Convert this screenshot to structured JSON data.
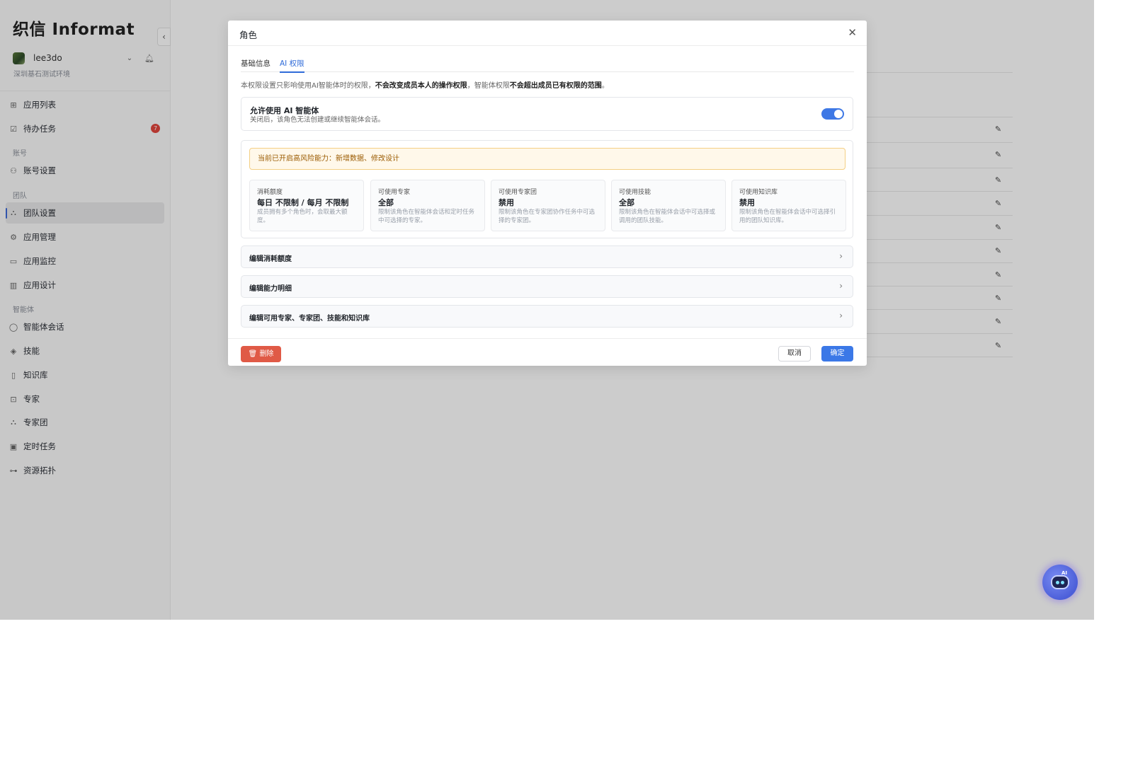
{
  "brand": {
    "name": "织信 Informat"
  },
  "user": {
    "name": "lee3do",
    "org": "深圳基石测试环境"
  },
  "sidebar": {
    "items": [
      {
        "label": "应用列表",
        "icon": "grid-icon"
      },
      {
        "label": "待办任务",
        "icon": "checkbox-icon",
        "badge": "7"
      }
    ],
    "section_account": "账号",
    "account_items": [
      {
        "label": "账号设置",
        "icon": "user-gear-icon"
      }
    ],
    "section_team": "团队",
    "team_items": [
      {
        "label": "团队设置",
        "icon": "team-icon",
        "active": true
      },
      {
        "label": "应用管理",
        "icon": "gear-icon"
      },
      {
        "label": "应用监控",
        "icon": "monitor-icon"
      },
      {
        "label": "应用设计",
        "icon": "design-icon"
      }
    ],
    "section_agent": "智能体",
    "agent_items": [
      {
        "label": "智能体会话",
        "icon": "chat-icon"
      },
      {
        "label": "技能",
        "icon": "layers-icon"
      },
      {
        "label": "知识库",
        "icon": "book-icon"
      },
      {
        "label": "专家",
        "icon": "robot-icon"
      },
      {
        "label": "专家团",
        "icon": "team-icon"
      },
      {
        "label": "定时任务",
        "icon": "calendar-clock-icon"
      },
      {
        "label": "资源拓扑",
        "icon": "topology-icon"
      }
    ]
  },
  "modal": {
    "title": "角色",
    "tabs": [
      {
        "label": "基础信息"
      },
      {
        "label": "AI 权限",
        "active": true
      }
    ],
    "description": {
      "part1": "本权限设置只影响使用AI智能体时的权限，",
      "bold1": "不会改变成员本人的操作权限",
      "part2": "，智能体权限",
      "bold2": "不会超出成员已有权限的范围",
      "part3": "。"
    },
    "allow": {
      "title": "允许使用 AI 智能体",
      "subtitle": "关闭后，该角色无法创建或继续智能体会话。",
      "enabled": true
    },
    "warning": "当前已开启高风险能力：新增数据、修改设计",
    "metrics": [
      {
        "label": "消耗额度",
        "value": "每日 不限制 / 每月 不限制",
        "desc": "成员拥有多个角色时，会取最大额度。"
      },
      {
        "label": "可使用专家",
        "value": "全部",
        "desc": "限制该角色在智能体会话和定时任务中可选择的专家。"
      },
      {
        "label": "可使用专家团",
        "value": "禁用",
        "desc": "限制该角色在专家团协作任务中可选择的专家团。"
      },
      {
        "label": "可使用技能",
        "value": "全部",
        "desc": "限制该角色在智能体会话中可选择或调用的团队技能。"
      },
      {
        "label": "可使用知识库",
        "value": "禁用",
        "desc": "限制该角色在智能体会话中可选择引用的团队知识库。"
      }
    ],
    "rows": [
      {
        "label": "编辑消耗额度"
      },
      {
        "label": "编辑能力明细"
      },
      {
        "label": "编辑可用专家、专家团、技能和知识库"
      }
    ],
    "footer": {
      "delete_label": "删除",
      "cancel_label": "取消",
      "ok_label": "确定"
    }
  },
  "colors": {
    "accent": "#3b78e7",
    "danger": "#e05a46",
    "warning_bg": "#fff8ea",
    "badge": "#e2453c"
  }
}
